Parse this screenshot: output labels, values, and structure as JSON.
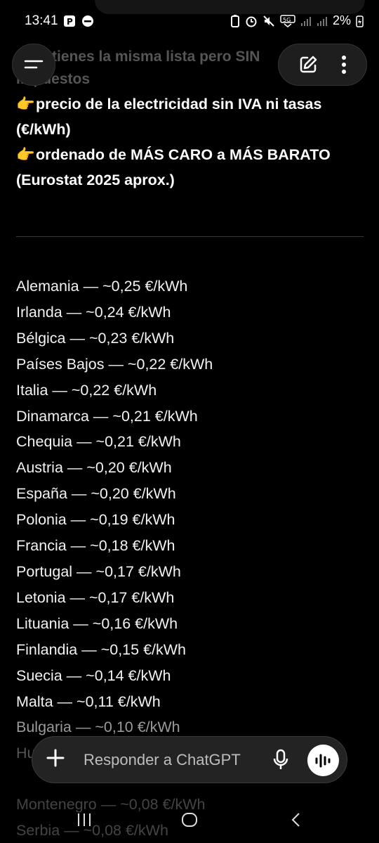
{
  "status": {
    "time": "13:41",
    "battery": "2%"
  },
  "intro": {
    "faded_line": "…tienes la misma lista pero SIN",
    "line_impuestos": "impuestos",
    "bullet1": "precio de la electricidad sin IVA ni tasas (€/kWh)",
    "bullet2": "ordenado de MÁS CARO a MÁS BARATO (Eurostat 2025 aprox.)"
  },
  "countries": [
    "Alemania — ~0,25 €/kWh",
    "Irlanda — ~0,24 €/kWh",
    "Bélgica — ~0,23 €/kWh",
    "Países Bajos — ~0,22 €/kWh",
    "Italia — ~0,22 €/kWh",
    "Dinamarca — ~0,21 €/kWh",
    "Chequia — ~0,21 €/kWh",
    "Austria — ~0,20 €/kWh",
    "España — ~0,20 €/kWh",
    "Polonia — ~0,19 €/kWh",
    "Francia — ~0,18 €/kWh",
    "Portugal — ~0,17 €/kWh",
    "Letonia — ~0,17 €/kWh",
    "Lituania — ~0,16 €/kWh",
    "Finlandia — ~0,15 €/kWh",
    "Suecia — ~0,14 €/kWh",
    "Malta — ~0,11 €/kWh",
    "Bulgaria — ~0,10 €/kWh",
    "Hu"
  ],
  "tail": [
    "Montenegro — ~0,08 €/kWh",
    "Serbia — ~0,08 €/kWh"
  ],
  "input": {
    "placeholder": "Responder a ChatGPT"
  },
  "icons": {
    "menu": "menu-icon",
    "edit": "new-chat-icon",
    "more": "more-vertical-icon",
    "plus": "plus-icon",
    "mic": "mic-icon",
    "voice": "voice-mode-icon",
    "pointing": "backhand-index-pointing-right-emoji"
  }
}
